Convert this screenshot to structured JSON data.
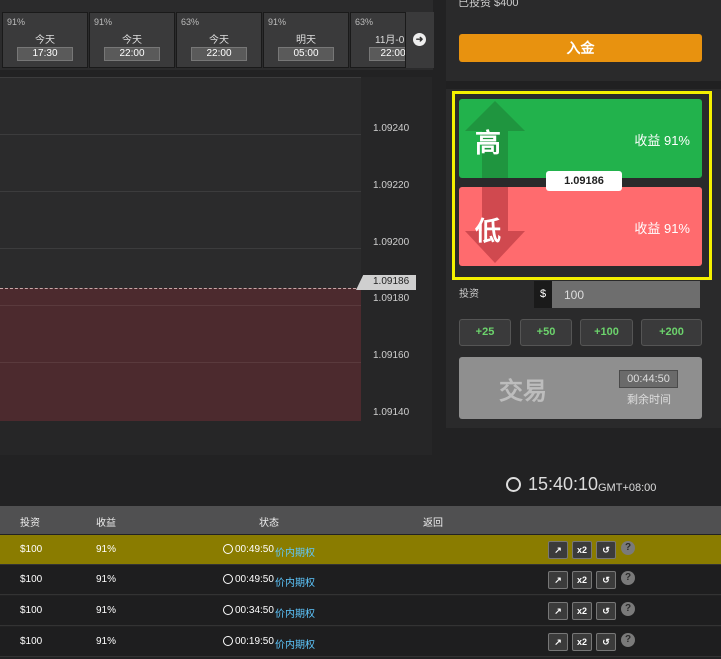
{
  "expiry_tabs": [
    {
      "pct": "91%",
      "day": "今天",
      "time": "17:30"
    },
    {
      "pct": "91%",
      "day": "今天",
      "time": "22:00"
    },
    {
      "pct": "63%",
      "day": "今天",
      "time": "22:00"
    },
    {
      "pct": "91%",
      "day": "明天",
      "time": "05:00"
    },
    {
      "pct": "63%",
      "day": "11月-0",
      "time": "22:00"
    }
  ],
  "chart": {
    "y_labels": [
      "1.09240",
      "1.09220",
      "1.09200",
      "1.09180",
      "1.09160",
      "1.09140"
    ],
    "current_price_tag": "1.09186"
  },
  "panel": {
    "invested_label": "已投资 $400",
    "deposit_label": "入金",
    "high_label": "高",
    "high_payout": "收益 91%",
    "low_label": "低",
    "low_payout": "收益 91%",
    "current_price": "1.09186",
    "invest_label": "投资",
    "currency": "$",
    "invest_value": "100",
    "quick_amounts": [
      "+25",
      "+50",
      "+100",
      "+200"
    ],
    "trade_label": "交易",
    "countdown": "00:44:50",
    "countdown_label": "剩余时间",
    "colors": {
      "high": "#22b24c",
      "low": "#ff6b6e",
      "deposit": "#e8920f",
      "highlight": "#f4f000"
    }
  },
  "clock": {
    "time": "15:40:10",
    "tz": "GMT+08:00"
  },
  "table": {
    "headers": {
      "invest": "投资",
      "payout": "收益",
      "status": "状态",
      "return": "返回"
    },
    "rows": [
      {
        "invest": "$100",
        "payout": "91%",
        "time": "00:49:50",
        "status": "价内期权",
        "active": true
      },
      {
        "invest": "$100",
        "payout": "91%",
        "time": "00:49:50",
        "status": "价内期权",
        "active": false
      },
      {
        "invest": "$100",
        "payout": "91%",
        "time": "00:34:50",
        "status": "价内期权",
        "active": false
      },
      {
        "invest": "$100",
        "payout": "91%",
        "time": "00:19:50",
        "status": "价内期权",
        "active": false
      }
    ],
    "actions": {
      "double": "x2",
      "help": "?"
    }
  }
}
